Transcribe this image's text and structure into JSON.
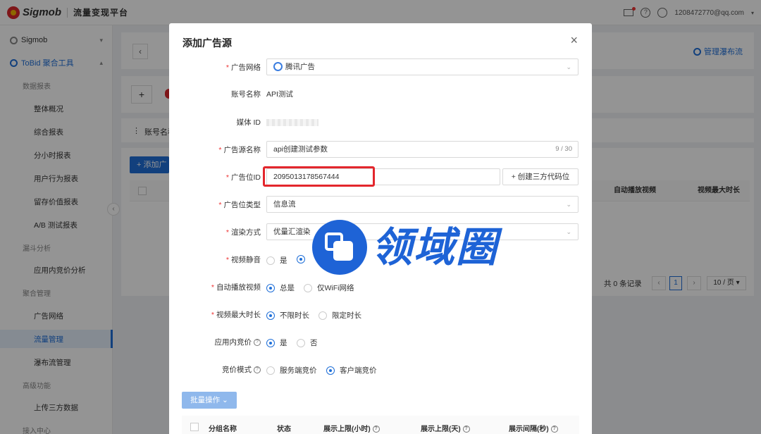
{
  "header": {
    "brand": "Sigmob",
    "platform": "流量变现平台",
    "user_email": "1208472770@qq.com"
  },
  "sidebar": {
    "group_sigmob": "Sigmob",
    "group_tobid": "ToBid 聚合工具",
    "cat_reports": "数据报表",
    "item_overview": "整体概况",
    "item_composite": "综合报表",
    "item_hourly": "分小时报表",
    "item_behavior": "用户行为报表",
    "item_retention": "留存价值报表",
    "item_ab": "A/B 测试报表",
    "cat_funnel": "漏斗分析",
    "item_inapp": "应用内竞价分析",
    "cat_mediation": "聚合管理",
    "item_network": "广告网络",
    "item_traffic": "流量管理",
    "item_waterfall": "瀑布流管理",
    "cat_advanced": "高级功能",
    "item_upload": "上传三方数据",
    "cat_access": "接入中心"
  },
  "background": {
    "manage_waterfall": "管理瀑布流",
    "account_name": "账号名称",
    "add_button": "+ 添加广",
    "col_autoplay": "自动播放视频",
    "col_maxlen": "视频最大时长",
    "total": "共 0 条记录",
    "page_current": "1",
    "page_size": "10 / 页"
  },
  "modal": {
    "title": "添加广告源",
    "ad_network_label": "广告网络",
    "ad_network_value": "腾讯广告",
    "account_label": "账号名称",
    "account_value": "API测试",
    "media_id_label": "媒体 ID",
    "source_name_label": "广告源名称",
    "source_name_value": "api创建测试参数",
    "source_name_count": "9 / 30",
    "placement_id_label": "广告位ID",
    "placement_id_value": "2095013178567444",
    "create_code_button": "+ 创建三方代码位",
    "placement_type_label": "广告位类型",
    "placement_type_value": "信息流",
    "render_label": "渲染方式",
    "render_value": "优量汇渲染",
    "mute_label": "视频静音",
    "mute_yes": "是",
    "autoplay_label": "自动播放视频",
    "autoplay_always": "总是",
    "autoplay_wifi": "仅WiFi网络",
    "maxlen_label": "视频最大时长",
    "maxlen_unlimited": "不限时长",
    "maxlen_limited": "限定时长",
    "inapp_label": "应用内竞价",
    "inapp_yes": "是",
    "inapp_no": "否",
    "bid_mode_label": "竞价模式",
    "bid_server": "服务端竞价",
    "bid_client": "客户端竞价",
    "batch_button": "批量操作",
    "col_group": "分组名称",
    "col_status": "状态",
    "col_hour_cap": "展示上限(小时)",
    "col_day_cap": "展示上限(天)",
    "col_interval": "展示间隔(秒)"
  },
  "watermark": {
    "text": "领域圈"
  }
}
